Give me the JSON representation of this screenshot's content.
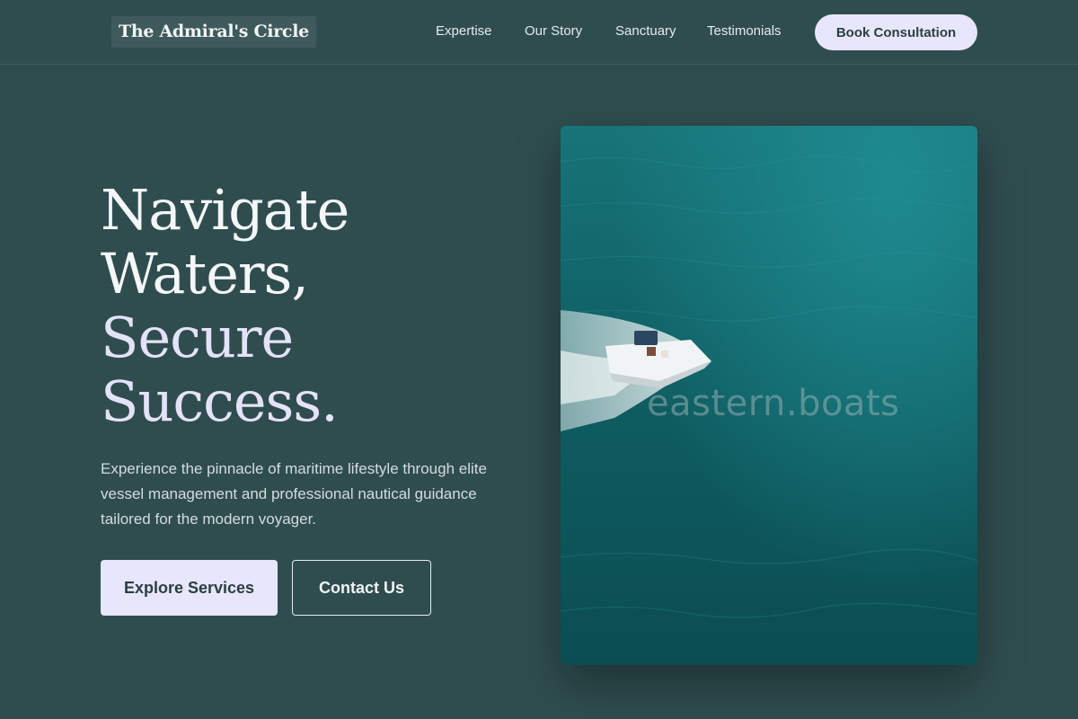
{
  "header": {
    "logo": "The Admiral's Circle",
    "nav": [
      "Expertise",
      "Our Story",
      "Sanctuary",
      "Testimonials"
    ],
    "cta": "Book Consultation"
  },
  "hero": {
    "title_line1": "Navigate",
    "title_line2": "Waters,",
    "title_line3": "Secure",
    "title_line4": "Success.",
    "description": "Experience the pinnacle of maritime lifestyle through elite vessel management and professional nautical guidance tailored for the modern voyager.",
    "primary_button": "Explore Services",
    "secondary_button": "Contact Us",
    "image": {
      "subject": "aerial view of speedboat on teal water",
      "watermark": "eastern.boats"
    }
  },
  "colors": {
    "background": "#2f4d4f",
    "accent": "#e8e6fb",
    "water": "#0f5f63"
  }
}
